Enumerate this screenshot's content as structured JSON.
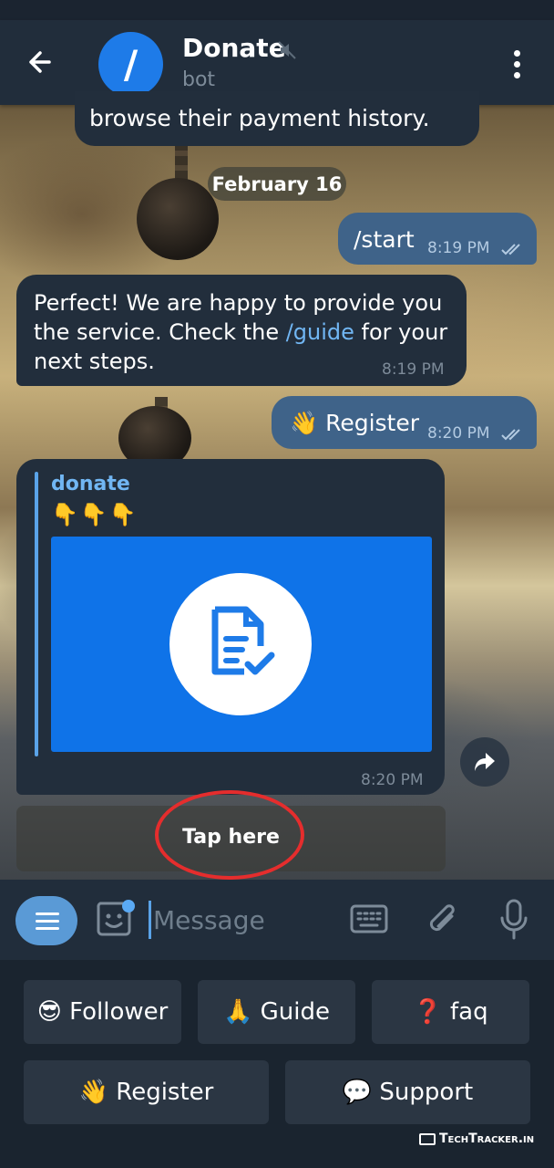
{
  "header": {
    "back_icon": "arrow-left-icon",
    "avatar_glyph": "/",
    "title": "Donate",
    "subtitle": "bot",
    "mute_icon": "muted-speaker-icon",
    "menu_icon": "more-vertical-icon"
  },
  "chat": {
    "partial_message": "browse their payment history.",
    "date_chip": "February 16",
    "messages": [
      {
        "direction": "out",
        "text": "/start",
        "time": "8:19 PM",
        "status_icon": "double-check-icon"
      },
      {
        "direction": "in",
        "text_before": "Perfect! We are happy to provide you the service. Check the ",
        "link": "/guide",
        "text_after": " for your next steps.",
        "time": "8:19 PM"
      },
      {
        "direction": "out",
        "emoji": "👋",
        "text": "Register",
        "time": "8:20 PM",
        "status_icon": "double-check-icon"
      },
      {
        "direction": "in",
        "quote_author": "donate",
        "quote_emojis": "👇👇👇",
        "image_icon": "document-check-icon",
        "time": "8:20 PM"
      }
    ],
    "share_icon": "share-forward-icon",
    "inline_button": "Tap here"
  },
  "composer": {
    "menu_icon": "hamburger-menu-icon",
    "sticker_icon": "sticker-smile-icon",
    "placeholder": "Message",
    "keyboard_icon": "keyboard-icon",
    "attach_icon": "paperclip-icon",
    "mic_icon": "microphone-icon"
  },
  "keyboard": {
    "row1": [
      {
        "emoji": "😎",
        "label": "Follower"
      },
      {
        "emoji": "🙏",
        "label": "Guide"
      },
      {
        "emoji": "❓",
        "label": "faq"
      }
    ],
    "row2": [
      {
        "emoji": "👋",
        "label": "Register"
      },
      {
        "emoji": "💬",
        "label": "Support"
      }
    ]
  },
  "watermark": "TechTracker.in",
  "colors": {
    "accent": "#1e7be8",
    "bubble_in": "#222e3c",
    "bubble_out": "#3f6389",
    "link": "#71b6f3",
    "annotation_circle": "#e52d2d"
  }
}
